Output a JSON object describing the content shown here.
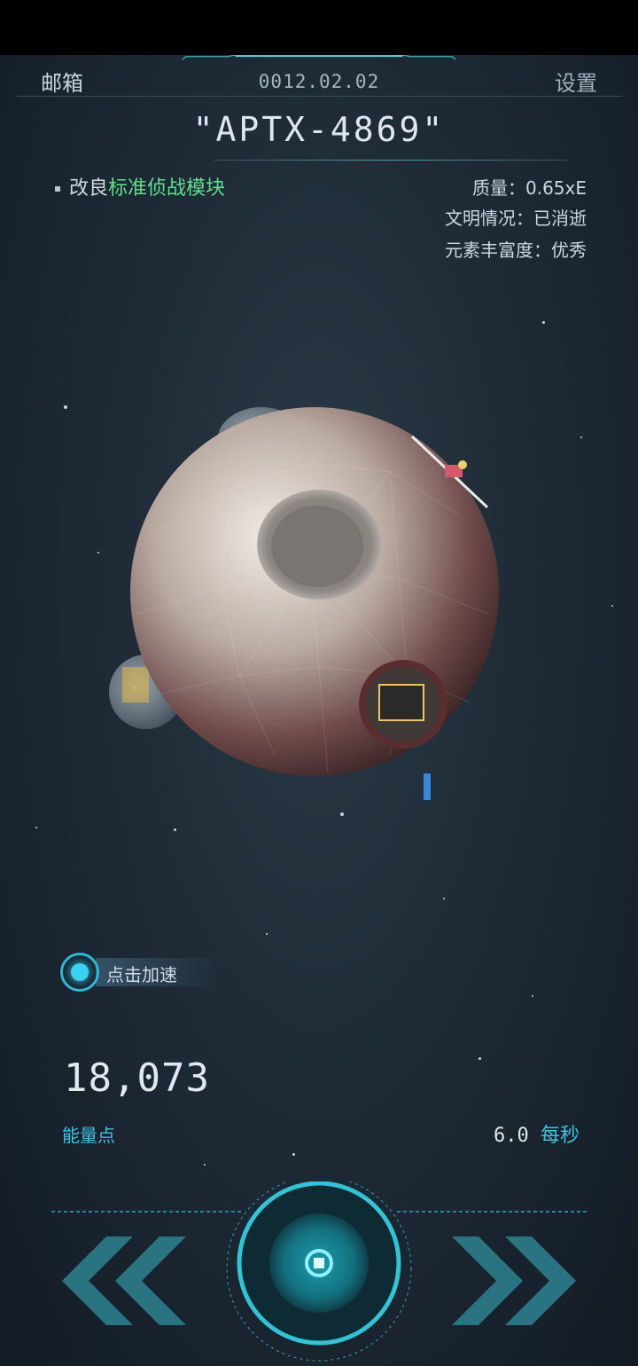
{
  "header": {
    "mail_label": "邮箱",
    "date": "0012.02.02",
    "settings_label": "设置"
  },
  "planet": {
    "name": "\"APTX-4869\"",
    "module_prefix": "改良",
    "module_name": "标准侦战模块",
    "mass": "质量：0.65xE",
    "civilization": "文明情况：已消逝",
    "abundance": "元素丰富度：优秀"
  },
  "boost": {
    "label": "点击加速"
  },
  "energy": {
    "value": "18,073",
    "label": "能量点",
    "rate_value": "6.0",
    "rate_unit": "每秒"
  },
  "colors": {
    "accent": "#3ac6e2",
    "highlight": "#5ee08a",
    "background": "#1e2b37"
  },
  "icons": {
    "prev": "double-chevron-left-icon",
    "center": "target-button-icon",
    "next": "double-chevron-right-icon"
  }
}
